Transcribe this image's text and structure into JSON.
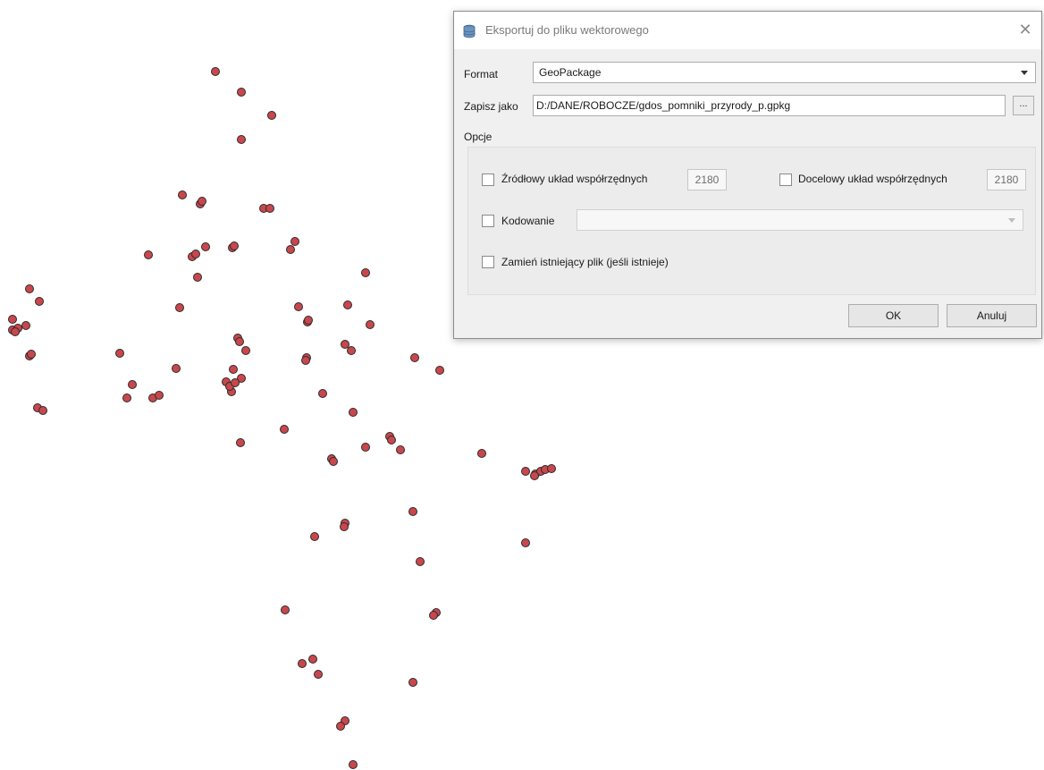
{
  "dialog": {
    "title": "Eksportuj do pliku wektorowego",
    "title_icon": "database-icon",
    "close_icon": "close-icon",
    "close_glyph": "✕",
    "format_label": "Format",
    "format_value": "GeoPackage",
    "save_as_label": "Zapisz jako",
    "save_as_value": "D:/DANE/ROBOCZE/gdos_pomniki_przyrody_p.gpkg",
    "browse_label": "...",
    "options_label": "Opcje",
    "source_crs_label": "Źródłowy układ współrzędnych",
    "source_crs_value": "2180",
    "source_crs_checked": false,
    "target_crs_label": "Docelowy układ współrzędnych",
    "target_crs_value": "2180",
    "target_crs_checked": false,
    "encoding_label": "Kodowanie",
    "encoding_value": "",
    "encoding_checked": false,
    "overwrite_label": "Zamień istniejący plik (jeśli istnieje)",
    "overwrite_checked": false,
    "ok_label": "OK",
    "cancel_label": "Anuluj"
  },
  "map": {
    "point_fill": "#c8474d",
    "point_stroke": "#2b2b2b"
  }
}
